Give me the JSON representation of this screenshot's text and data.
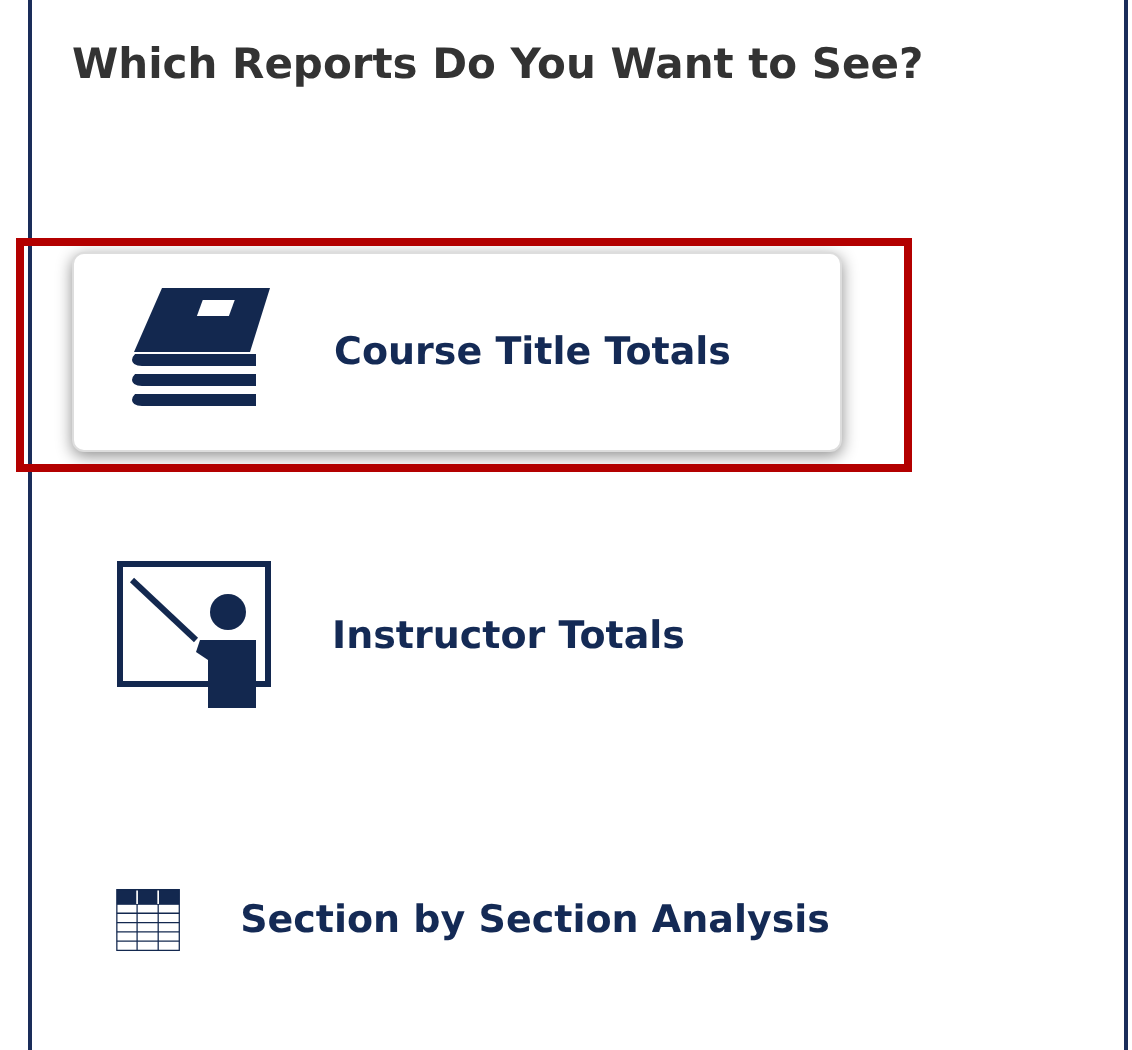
{
  "heading": "Which Reports Do You Want to See?",
  "reports": [
    {
      "label": "Course Title Totals",
      "kind": "books",
      "selected": true
    },
    {
      "label": "Instructor Totals",
      "kind": "instructor",
      "selected": false
    },
    {
      "label": "Section by Section Analysis",
      "kind": "table",
      "selected": false
    }
  ]
}
